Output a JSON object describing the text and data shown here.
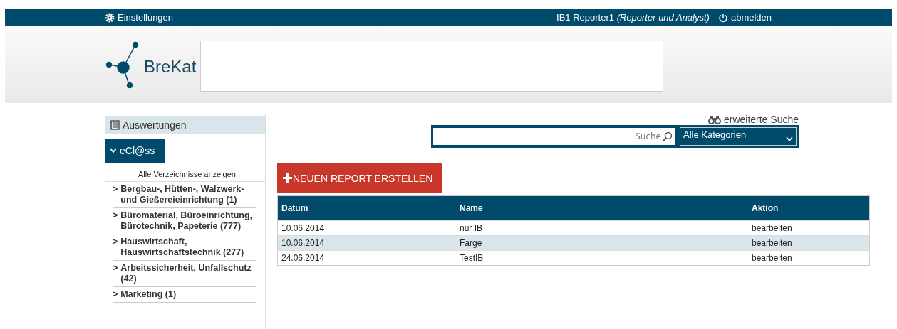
{
  "top_bar": {
    "settings": "Einstellungen",
    "user": "IB1 Reporter1",
    "role": "(Reporter und Analyst)",
    "logout": "abmelden"
  },
  "header": {
    "logo": "BreKat"
  },
  "sidebar": {
    "title": "Auswertungen",
    "tab": "eCl@ss",
    "tab_expanded": true,
    "show_all": {
      "label": "Alle Verzeichnisse anzeigen",
      "checked": false
    },
    "items": [
      {
        "marker": ">",
        "label": "Bergbau-, Hütten-, Walzwerk- und Gießereieinrichtung (1)"
      },
      {
        "marker": ">",
        "label": "Büromaterial, Büroeinrichtung, Bürotechnik, Papeterie (777)"
      },
      {
        "marker": ">",
        "label": "Hauswirtschaft, Hauswirtschaftstechnik (277)"
      },
      {
        "marker": ">",
        "label": "Arbeitssicherheit, Unfallschutz (42)"
      },
      {
        "marker": ">",
        "label": "Marketing (1)"
      }
    ]
  },
  "search": {
    "advanced": "erweiterte Suche",
    "button": "Suche",
    "category": "Alle Kategorien"
  },
  "new_report": "NEUEN REPORT ERSTELLEN",
  "table": {
    "columns": [
      "Datum",
      "Name",
      "Aktion"
    ],
    "rows": [
      [
        "10.06.2014",
        "nur IB",
        "bearbeiten"
      ],
      [
        "10.06.2014",
        "Farge",
        "bearbeiten"
      ],
      [
        "24.06.2014",
        "TestIB",
        "bearbeiten"
      ]
    ]
  }
}
